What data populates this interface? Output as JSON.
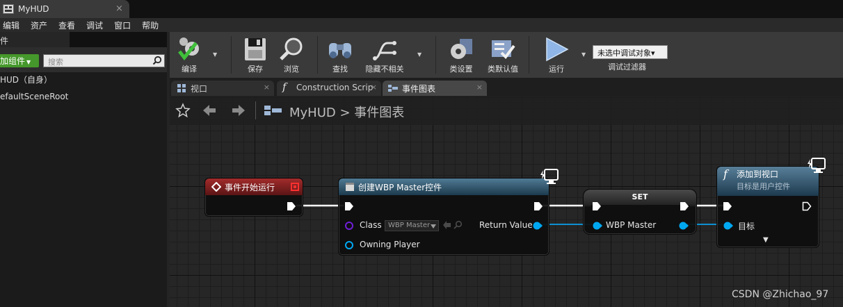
{
  "window": {
    "doc_tab": "MyHUD",
    "close": "×"
  },
  "menu": [
    "编辑",
    "资产",
    "查看",
    "调试",
    "窗口",
    "帮助"
  ],
  "left_panel": {
    "header": "件",
    "add_button": "加组件",
    "add_caret": "▼",
    "search_placeholder": "搜索",
    "components": [
      "HUD（自身）",
      "efaultSceneRoot"
    ]
  },
  "toolbar": {
    "compile": "编译",
    "save": "保存",
    "browse": "浏览",
    "find": "查找",
    "hide_unrelated": "隐藏不相关",
    "class_settings": "类设置",
    "class_defaults": "类默认值",
    "play": "运行",
    "debug_object": "未选中调试对象▾",
    "debug_filter": "调试过滤器",
    "caret": "▼"
  },
  "graph_tabs": [
    {
      "label": "视口",
      "close": "×"
    },
    {
      "label": "Construction Scrip",
      "close": "×"
    },
    {
      "label": "事件图表",
      "close": "×"
    }
  ],
  "breadcrumb": {
    "text": "MyHUD > 事件图表"
  },
  "nodes": {
    "begin_play": {
      "title": "事件开始运行"
    },
    "create_widget": {
      "title": "创建WBP Master控件",
      "class_label": "Class",
      "class_value": "WBP Master",
      "owning_player": "Owning Player",
      "return_value": "Return Value"
    },
    "set": {
      "title": "SET",
      "var": "WBP Master"
    },
    "add_to_viewport": {
      "title": "添加到视口",
      "subtitle": "目标是用户控件",
      "target": "目标",
      "expand": "▼"
    }
  },
  "colors": {
    "exec": "#ffffff",
    "object_pin": "#00a8f2",
    "class_pin": "#6f1fd8",
    "event_head": "#a32b2b",
    "function_head": "#507a94",
    "add_button": "#45982b"
  },
  "watermark": "CSDN @Zhichao_97"
}
